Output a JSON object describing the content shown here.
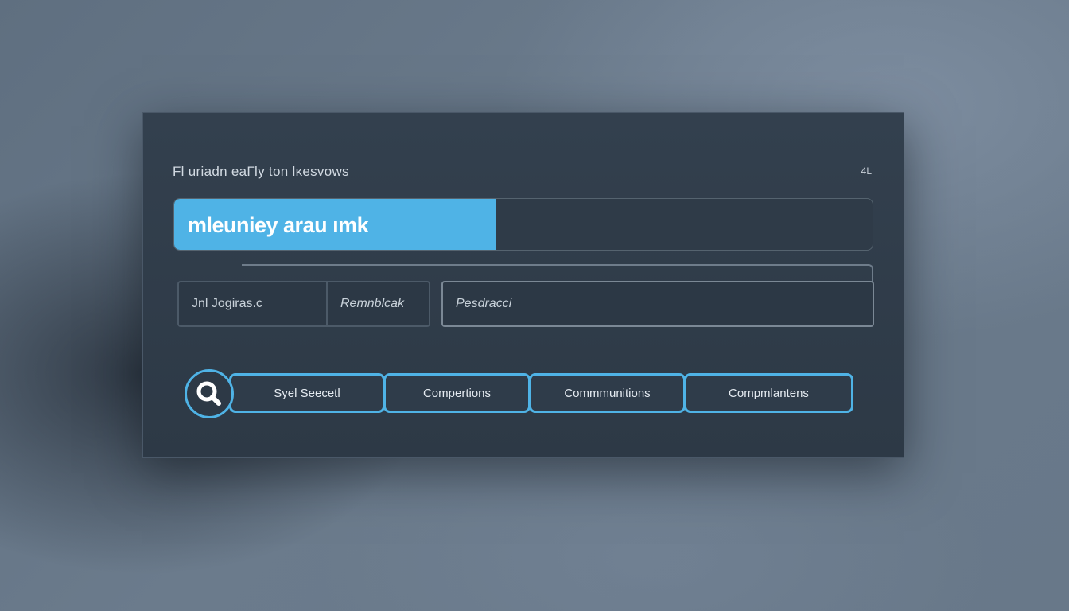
{
  "panel": {
    "title": "Fl uriadn eaΓly ton lκesvows",
    "corner_mark": "4L"
  },
  "progress": {
    "label": "mleuniey arau ımk",
    "fraction": 0.46,
    "color": "#4fb3e6"
  },
  "fields": {
    "first": "Jnl Jogiras.c",
    "second": "Remnblcak",
    "third": "Pesdracci"
  },
  "search": {
    "icon": "search-icon"
  },
  "pills": [
    {
      "label": "Syel Seecetl"
    },
    {
      "label": "Compertions"
    },
    {
      "label": "Commmunitions"
    },
    {
      "label": "Compmlantens"
    }
  ],
  "colors": {
    "accent": "#4fb3e6",
    "panel_bg": "#2f3b48",
    "background": "#66788a"
  }
}
